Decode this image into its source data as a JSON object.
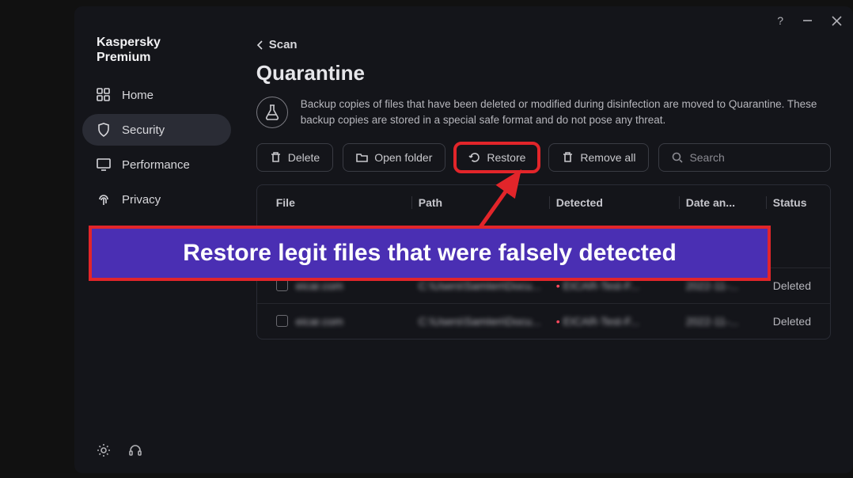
{
  "brand_line1": "Kaspersky",
  "brand_line2": "Premium",
  "nav": {
    "home": "Home",
    "security": "Security",
    "performance": "Performance",
    "privacy": "Privacy"
  },
  "back_label": "Scan",
  "page_title": "Quarantine",
  "description": "Backup copies of files that have been deleted or modified during disinfection are moved to Quarantine. These backup copies are stored in a special safe format and do not pose any threat.",
  "toolbar": {
    "delete": "Delete",
    "open_folder": "Open folder",
    "restore": "Restore",
    "remove_all": "Remove all",
    "search_placeholder": "Search"
  },
  "columns": {
    "file": "File",
    "path": "Path",
    "detected": "Detected",
    "date": "Date an...",
    "status": "Status"
  },
  "rows": [
    {
      "file": "eicar.com",
      "path": "C:\\Users\\SamIen\\Docu...",
      "detected": "EICAR-Test-F...",
      "date": "2022-11-...",
      "status": "Deleted"
    },
    {
      "file": "eicar.com",
      "path": "C:\\Users\\SamIen\\Docu...",
      "detected": "EICAR-Test-F...",
      "date": "2022-11-...",
      "status": "Deleted"
    }
  ],
  "callout_text": "Restore legit files that were falsely detected"
}
